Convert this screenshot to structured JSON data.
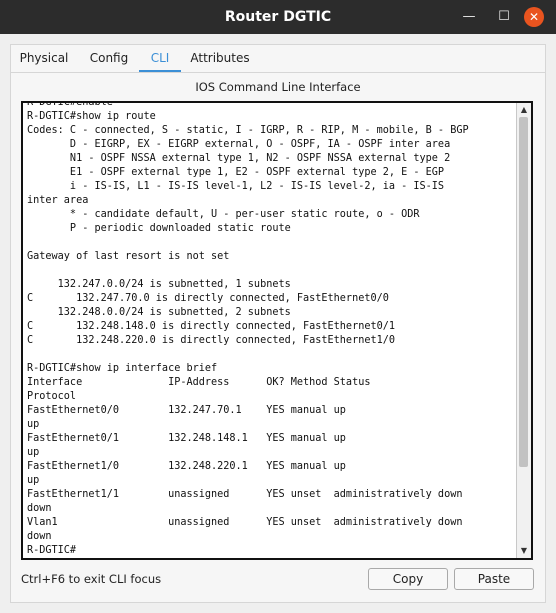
{
  "window": {
    "title": "Router DGTIC",
    "minimize": "—",
    "maximize": "☐",
    "close": "✕"
  },
  "tabs": [
    {
      "label": "Physical"
    },
    {
      "label": "Config"
    },
    {
      "label": "CLI"
    },
    {
      "label": "Attributes"
    }
  ],
  "active_tab": "CLI",
  "cli": {
    "heading": "IOS Command Line Interface",
    "output": "R-DGTIC#enable\nR-DGTIC#show ip route\nCodes: C - connected, S - static, I - IGRP, R - RIP, M - mobile, B - BGP\n       D - EIGRP, EX - EIGRP external, O - OSPF, IA - OSPF inter area\n       N1 - OSPF NSSA external type 1, N2 - OSPF NSSA external type 2\n       E1 - OSPF external type 1, E2 - OSPF external type 2, E - EGP\n       i - IS-IS, L1 - IS-IS level-1, L2 - IS-IS level-2, ia - IS-IS\ninter area\n       * - candidate default, U - per-user static route, o - ODR\n       P - periodic downloaded static route\n\nGateway of last resort is not set\n\n     132.247.0.0/24 is subnetted, 1 subnets\nC       132.247.70.0 is directly connected, FastEthernet0/0\n     132.248.0.0/24 is subnetted, 2 subnets\nC       132.248.148.0 is directly connected, FastEthernet0/1\nC       132.248.220.0 is directly connected, FastEthernet1/0\n\nR-DGTIC#show ip interface brief\nInterface              IP-Address      OK? Method Status\nProtocol\nFastEthernet0/0        132.247.70.1    YES manual up\nup\nFastEthernet0/1        132.248.148.1   YES manual up\nup\nFastEthernet1/0        132.248.220.1   YES manual up\nup\nFastEthernet1/1        unassigned      YES unset  administratively down\ndown\nVlan1                  unassigned      YES unset  administratively down\ndown\nR-DGTIC#"
  },
  "footer": {
    "hint": "Ctrl+F6 to exit CLI focus",
    "copy_label": "Copy",
    "paste_label": "Paste"
  }
}
